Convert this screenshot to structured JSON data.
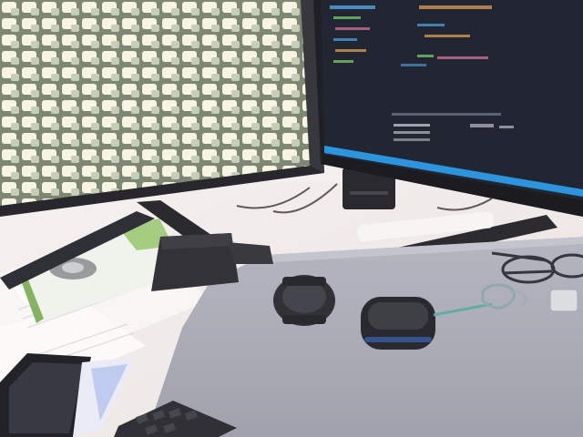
{
  "scene": {
    "kind": "photo",
    "colors": {
      "wall": "#f4efee",
      "desk": "#f1ebe9",
      "laptop_lid": "#a7a7b3",
      "monitor_bezel": "#17171d",
      "code_bg": "#151826",
      "accent_blue": "#1f8fdc",
      "dark_object": "#2a2a33"
    },
    "objects": [
      "left-monitor",
      "right-monitor",
      "monitor-stand",
      "desk-surface",
      "laptop",
      "smartphone",
      "wallet",
      "smartwatch",
      "earbuds-case",
      "keychain",
      "eyeglasses",
      "keyboard",
      "papers",
      "camera-box",
      "speaker"
    ]
  }
}
